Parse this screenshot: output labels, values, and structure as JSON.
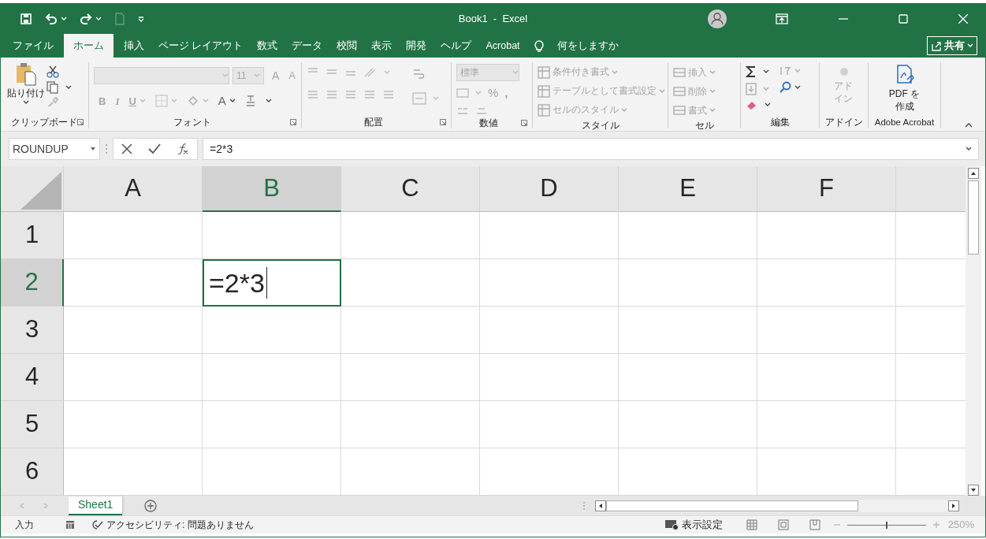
{
  "window": {
    "title": "Book1  -  Excel"
  },
  "menu_tabs": [
    {
      "label": "ファイル",
      "selected": false
    },
    {
      "label": "ホーム",
      "selected": true
    },
    {
      "label": "挿入",
      "selected": false
    },
    {
      "label": "ページ レイアウト",
      "selected": false
    },
    {
      "label": "数式",
      "selected": false
    },
    {
      "label": "データ",
      "selected": false
    },
    {
      "label": "校閲",
      "selected": false
    },
    {
      "label": "表示",
      "selected": false
    },
    {
      "label": "開発",
      "selected": false
    },
    {
      "label": "ヘルプ",
      "selected": false
    },
    {
      "label": "Acrobat",
      "selected": false
    }
  ],
  "tell_me": {
    "placeholder": "何をしますか"
  },
  "share_button": {
    "label": "共有"
  },
  "ribbon": {
    "clipboard": {
      "label": "クリップボード",
      "paste": "貼り付け"
    },
    "font": {
      "label": "フォント",
      "size": "11",
      "grow": "A",
      "shrink": "A",
      "style_buttons": [
        "B",
        "I",
        "U"
      ],
      "font_color": "A"
    },
    "alignment": {
      "label": "配置"
    },
    "number": {
      "label": "数値",
      "format": "標準",
      "symbols": [
        "%",
        ","
      ]
    },
    "styles": {
      "label": "スタイル",
      "commands": [
        {
          "label": "条件付き書式"
        },
        {
          "label": "テーブルとして書式設定"
        },
        {
          "label": "セルのスタイル"
        }
      ]
    },
    "cells": {
      "label": "セル",
      "commands": [
        {
          "label": "挿入"
        },
        {
          "label": "削除"
        },
        {
          "label": "書式"
        }
      ]
    },
    "editing": {
      "label": "編集"
    },
    "addins": {
      "label": "アドイン",
      "button": "アドイン"
    },
    "acrobat": {
      "label": "Adobe Acrobat",
      "button": "PDF を作成"
    }
  },
  "formula_bar": {
    "name_box": "ROUNDUP",
    "formula": "=2*3"
  },
  "sheet": {
    "columns": [
      {
        "label": "A",
        "selected": false
      },
      {
        "label": "B",
        "selected": true
      },
      {
        "label": "C",
        "selected": false
      },
      {
        "label": "D",
        "selected": false
      },
      {
        "label": "E",
        "selected": false
      },
      {
        "label": "F",
        "selected": false
      }
    ],
    "rows": [
      {
        "label": "1",
        "selected": false
      },
      {
        "label": "2",
        "selected": true
      },
      {
        "label": "3",
        "selected": false
      },
      {
        "label": "4",
        "selected": false
      },
      {
        "label": "5",
        "selected": false
      },
      {
        "label": "6",
        "selected": false
      }
    ],
    "active_cell": {
      "text": "=2*3",
      "editing": true
    }
  },
  "sheet_tabs": [
    {
      "label": "Sheet1",
      "selected": true
    }
  ],
  "status_bar": {
    "mode": "入力",
    "accessibility": "アクセシビリティ: 問題ありません",
    "display_settings": "表示設定",
    "zoom_slider": {
      "level": 0.5
    },
    "zoom": "250%"
  }
}
